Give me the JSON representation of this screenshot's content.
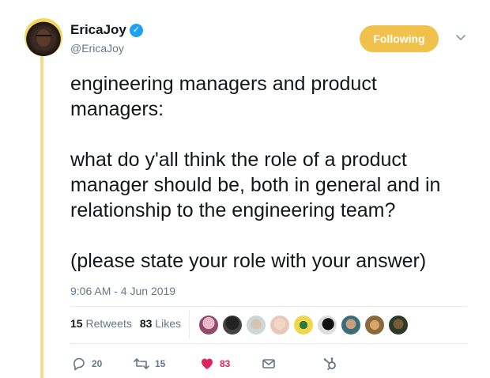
{
  "author": {
    "display_name": "EricaJoy",
    "handle": "@EricaJoy",
    "verified_icon": "verified-badge-icon"
  },
  "follow_button": {
    "label": "Following",
    "color": "#f0c14b"
  },
  "tweet": {
    "paragraphs": [
      "engineering managers and product managers:",
      "what do y'all think the role of a product manager should be, both in general and in relationship to the engineering team?",
      "(please state your role with your answer)"
    ],
    "timestamp": "9:06 AM - 4 Jun 2019"
  },
  "stats": {
    "retweets_count": "15",
    "retweets_label": "Retweets",
    "likes_count": "83",
    "likes_label": "Likes"
  },
  "actions": {
    "replies": "20",
    "retweets": "15",
    "likes": "83"
  },
  "colors": {
    "thread_line": "#f6dc8a",
    "like_heart": "#e0245e",
    "secondary_text": "#657786"
  }
}
